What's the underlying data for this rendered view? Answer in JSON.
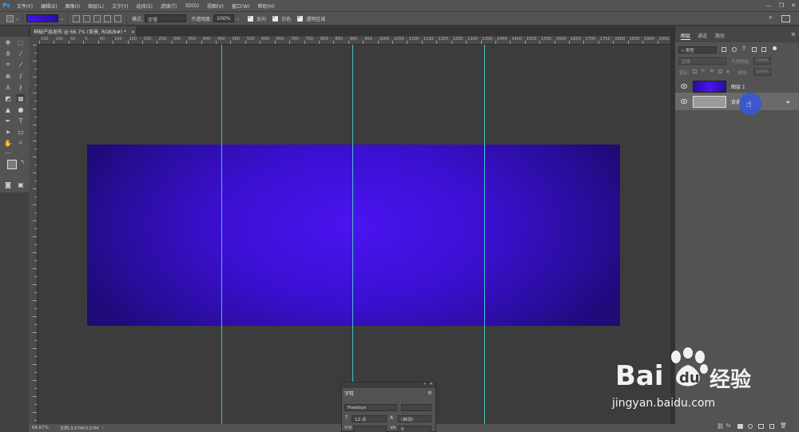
{
  "app": {
    "logo": "Ps"
  },
  "menu": [
    "文件(F)",
    "编辑(E)",
    "图像(I)",
    "图层(L)",
    "文字(Y)",
    "选择(S)",
    "滤镜(T)",
    "3D(D)",
    "视图(V)",
    "窗口(W)",
    "帮助(H)"
  ],
  "window_controls": {
    "minimize": "—",
    "maximize": "❐",
    "close": "✕"
  },
  "options": {
    "mode_label": "模式:",
    "mode_value": "正常",
    "opacity_label": "不透明度:",
    "opacity_value": "100%",
    "reverse_label": "反向",
    "dither_label": "仿色",
    "transparency_label": "透明区域",
    "gradient_colors": [
      "#4a12e5",
      "#2c0fa8"
    ]
  },
  "document": {
    "tab_title": "神秘产品发布 @ 66.7% (背景, RGB/8#) *",
    "tab_close": "×",
    "zoom": "66.67%",
    "doc_info": "文档:3.57M/3.57M",
    "canvas_colors": [
      "#4a14f0",
      "#2a0d9c",
      "#1f0a78"
    ],
    "guide_color": "#3fc7c2"
  },
  "ruler": {
    "top_ticks": [
      "150",
      "100",
      "50",
      "0",
      "50",
      "100",
      "150",
      "200",
      "250",
      "300",
      "350",
      "400",
      "450",
      "500",
      "550",
      "600",
      "650",
      "700",
      "750",
      "800",
      "850",
      "900",
      "950",
      "1000",
      "1050",
      "1100",
      "1150",
      "1200",
      "1250",
      "1300",
      "1350",
      "1400",
      "1450",
      "1500",
      "1550",
      "1600",
      "1650",
      "1700",
      "1750",
      "1800",
      "1850",
      "1900",
      "1950"
    ]
  },
  "layers_panel": {
    "tabs": [
      "图层",
      "通道",
      "路径"
    ],
    "kind_filter": "类型",
    "blend_mode": "正常",
    "opacity_label": "不透明度:",
    "opacity_value": "100%",
    "lock_label": "锁定:",
    "fill_label": "填充:",
    "fill_value": "100%",
    "layers": [
      {
        "name": "图层 1",
        "thumb_color": "#3c10d8",
        "locked": false
      },
      {
        "name": "背景",
        "thumb_color": "#9a9a9a",
        "locked": true
      }
    ]
  },
  "character_panel": {
    "tab": "字符",
    "font_family": "Fixedsys",
    "font_size": "12 点",
    "leading": "(自动)",
    "kerning": "V/A",
    "tracking": "0"
  },
  "watermark": {
    "brand": "Bai",
    "brand2": "du",
    "cn": "经验",
    "url": "jingyan.baidu.com"
  }
}
